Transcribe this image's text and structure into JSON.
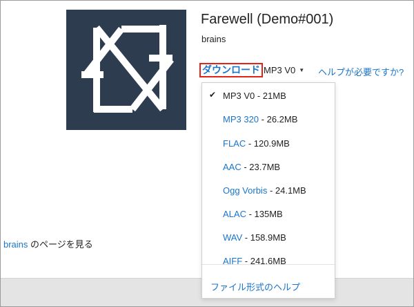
{
  "album": {
    "title": "Farewell (Demo#001)",
    "artist": "brains",
    "artwork_bg": "#2d3c4f"
  },
  "download": {
    "link_label": "ダウンロード",
    "selected_format": "MP3 V0",
    "help_label": "ヘルプが必要ですか?"
  },
  "formats": [
    {
      "name": "MP3 V0",
      "size": " - 21MB",
      "selected": true
    },
    {
      "name": "MP3 320",
      "size": " - 26.2MB",
      "selected": false
    },
    {
      "name": "FLAC",
      "size": " - 120.9MB",
      "selected": false
    },
    {
      "name": "AAC",
      "size": " - 23.7MB",
      "selected": false
    },
    {
      "name": "Ogg Vorbis",
      "size": " - 24.1MB",
      "selected": false
    },
    {
      "name": "ALAC",
      "size": " - 135MB",
      "selected": false
    },
    {
      "name": "WAV",
      "size": " - 158.9MB",
      "selected": false
    },
    {
      "name": "AIFF",
      "size": " - 241.6MB",
      "selected": false
    }
  ],
  "format_help": "ファイル形式のヘルプ",
  "artist_page": {
    "link": "brains",
    "suffix": " のページを見る"
  },
  "colors": {
    "link": "#1a75c9",
    "highlight_border": "#e2231a"
  },
  "icons": {
    "check": "checkmark-icon",
    "caret": "caret-down-icon"
  }
}
